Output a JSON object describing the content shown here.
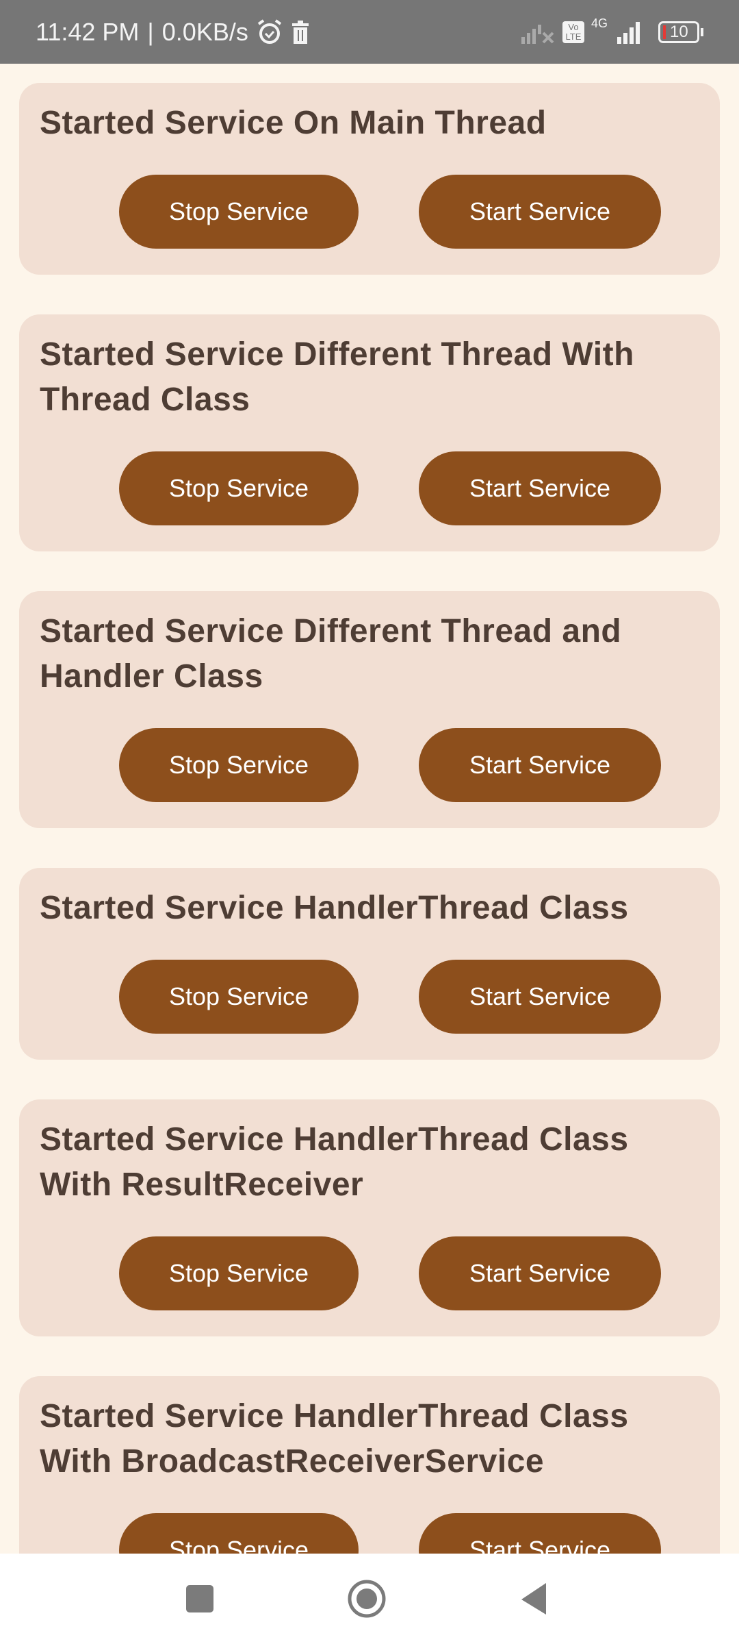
{
  "status_bar": {
    "time": "11:42 PM",
    "separator": "|",
    "speed": "0.0KB/s",
    "network": "4G",
    "volte": "Vo LTE",
    "battery": "10"
  },
  "cards": [
    {
      "title": "Started Service On Main Thread",
      "stop_label": "Stop Service",
      "start_label": "Start Service"
    },
    {
      "title": "Started Service Different Thread With Thread Class",
      "stop_label": "Stop Service",
      "start_label": "Start Service"
    },
    {
      "title": "Started Service Different Thread and Handler Class",
      "stop_label": "Stop Service",
      "start_label": "Start Service"
    },
    {
      "title": "Started Service HandlerThread Class",
      "stop_label": "Stop Service",
      "start_label": "Start Service"
    },
    {
      "title": "Started Service HandlerThread Class With ResultReceiver",
      "stop_label": "Stop Service",
      "start_label": "Start Service"
    },
    {
      "title": "Started Service HandlerThread Class With BroadcastReceiverService",
      "stop_label": "Stop Service",
      "start_label": "Start Service"
    }
  ],
  "colors": {
    "status_bar": "#767676",
    "background": "#fdf5ea",
    "card": "#f2dfd3",
    "button": "#8d4f1c",
    "title_text": "#4e3d34"
  },
  "nav_icons": [
    "recents-icon",
    "home-icon",
    "back-icon"
  ]
}
